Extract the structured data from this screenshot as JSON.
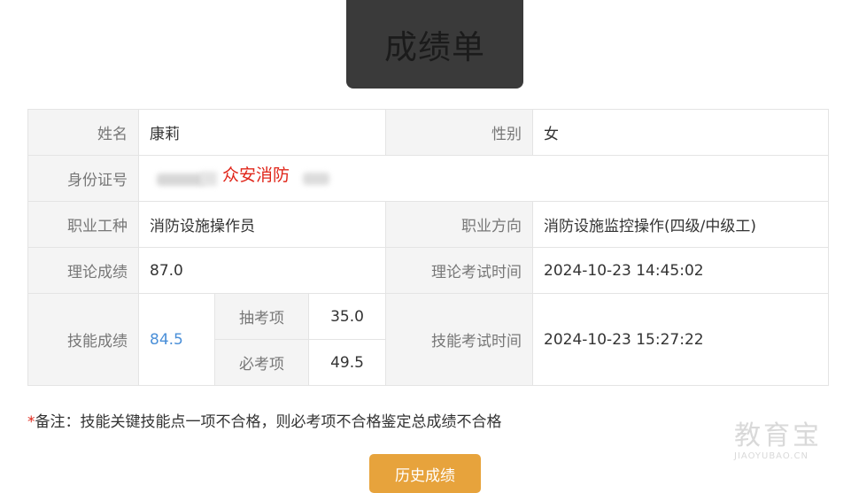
{
  "header": {
    "title": "成绩单"
  },
  "table": {
    "name_label": "姓名",
    "name_value": "康莉",
    "gender_label": "性别",
    "gender_value": "女",
    "id_label": "身份证号",
    "id_watermark": "众安消防",
    "job_label": "职业工种",
    "job_value": "消防设施操作员",
    "direction_label": "职业方向",
    "direction_value": "消防设施监控操作(四级/中级工)",
    "theory_label": "理论成绩",
    "theory_value": "87.0",
    "theory_time_label": "理论考试时间",
    "theory_time_value": "2024-10-23 14:45:02",
    "skill_label": "技能成绩",
    "skill_value": "84.5",
    "draw_label": "抽考项",
    "draw_value": "35.0",
    "required_label": "必考项",
    "required_value": "49.5",
    "skill_time_label": "技能考试时间",
    "skill_time_value": "2024-10-23 15:27:22"
  },
  "note": {
    "star": "*",
    "text": "备注：技能关键技能点一项不合格，则必考项不合格鉴定总成绩不合格"
  },
  "history_button": {
    "label": "历史成绩"
  },
  "site_watermark": {
    "big": "教育宝",
    "small": "JIAOYUBAO.CN"
  },
  "colors": {
    "accent": "#e7a33c",
    "link": "#4a8fd8",
    "red": "#e0261a",
    "header_bg": "#3a3a3a"
  }
}
